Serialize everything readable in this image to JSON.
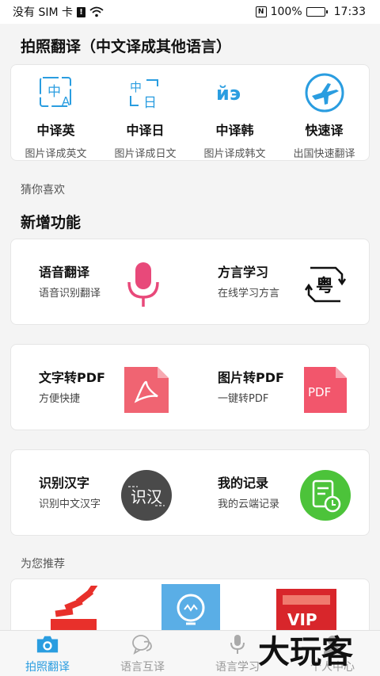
{
  "status": {
    "carrier": "没有 SIM 卡",
    "sim_badge": "!",
    "nfc": "N",
    "battery": "100%",
    "time": "17:33"
  },
  "photo_section": {
    "title": "拍照翻译（中文译成其他语言）",
    "items": [
      {
        "name": "中译英",
        "sub": "图片译成英文",
        "icon": "zh-en-icon"
      },
      {
        "name": "中译日",
        "sub": "图片译成日文",
        "icon": "zh-ja-icon"
      },
      {
        "name": "中译韩",
        "sub": "图片译成韩文",
        "icon": "zh-ko-icon"
      },
      {
        "name": "快速译",
        "sub": "出国快速翻译",
        "icon": "airplane-icon"
      }
    ],
    "icon_text": {
      "zh": "中",
      "a": "A",
      "ri": "日",
      "ko": "йэ"
    }
  },
  "guess_label": "猜你喜欢",
  "new_features": {
    "title": "新增功能",
    "cards": [
      [
        {
          "title": "语音翻译",
          "sub": "语音识别翻译",
          "icon": "microphone-icon"
        },
        {
          "title": "方言学习",
          "sub": "在线学习方言",
          "icon": "dialect-icon",
          "glyph": "粤"
        }
      ],
      [
        {
          "title": "文字转PDF",
          "sub": "方便快捷",
          "icon": "pdf-acrobat-icon"
        },
        {
          "title": "图片转PDF",
          "sub": "一键转PDF",
          "icon": "pdf-file-icon",
          "glyph": "PDF"
        }
      ],
      [
        {
          "title": "识别汉字",
          "sub": "识别中文汉字",
          "icon": "hanzi-recognize-icon",
          "glyph": "识汉"
        },
        {
          "title": "我的记录",
          "sub": "我的云端记录",
          "icon": "record-clock-icon"
        }
      ]
    ]
  },
  "recommend_label": "为您推荐",
  "recommend": {
    "vip": "VIP"
  },
  "tabs": [
    {
      "label": "拍照翻译",
      "icon": "camera-icon",
      "active": true
    },
    {
      "label": "语言互译",
      "icon": "translate-bubble-icon",
      "active": false
    },
    {
      "label": "语言学习",
      "icon": "mic-tab-icon",
      "active": false
    },
    {
      "label": "个人中心",
      "icon": "person-icon",
      "active": false
    }
  ],
  "watermark": "大玩客",
  "colors": {
    "accent": "#2a9de0",
    "mic": "#e8497a",
    "pdf": "#f06472",
    "green": "#4cc33a",
    "dark": "#4a4a4a"
  }
}
